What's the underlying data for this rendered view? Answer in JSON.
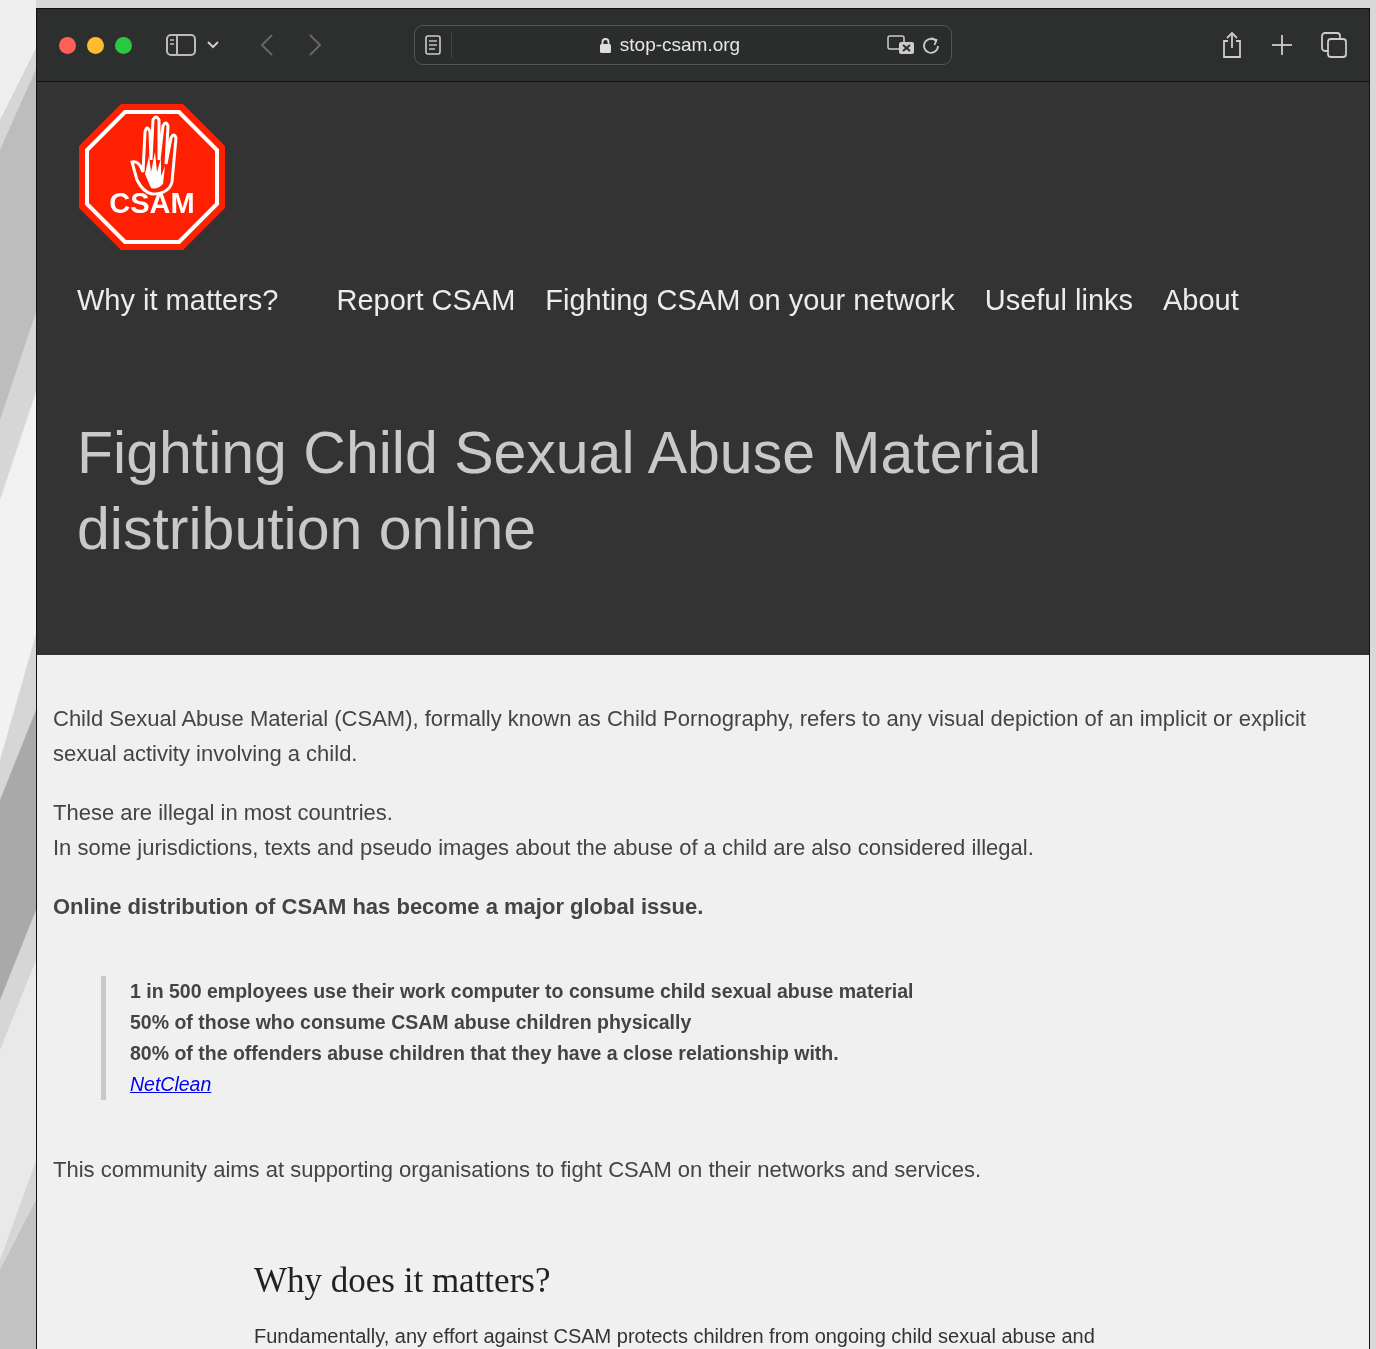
{
  "browser": {
    "url": "stop-csam.org"
  },
  "site": {
    "logo_text": "CSAM",
    "nav": [
      {
        "label": "Why it matters?"
      },
      {
        "label": "Report CSAM"
      },
      {
        "label": "Fighting CSAM on your network"
      },
      {
        "label": "Useful links"
      },
      {
        "label": "About"
      }
    ],
    "hero_title": "Fighting Child Sexual Abuse Material distribution online"
  },
  "content": [
    {
      "kind": "paragraph",
      "lines": [
        "Child Sexual Abuse Material (CSAM), formally known as Child Pornography, refers to any visual depiction of an implicit or explicit sexual activity involving a child."
      ]
    },
    {
      "kind": "paragraph",
      "lines": [
        "These are illegal in most countries.",
        "In some jurisdictions, texts and pseudo images about the abuse of a child are also considered illegal."
      ]
    },
    {
      "kind": "strong",
      "lines": [
        "Online distribution of CSAM has become a major global issue."
      ]
    },
    {
      "kind": "quote",
      "lines": [
        "1 in 500 employees use their work computer to consume child sexual abuse material",
        "50% of those who consume CSAM abuse children physically",
        "80% of the offenders abuse children that they have a close relationship with."
      ],
      "link": "NetClean"
    },
    {
      "kind": "paragraph",
      "lines": [
        "This community aims at supporting organisations to fight CSAM on their networks and services."
      ]
    }
  ],
  "section": {
    "heading": "Why does it matters?",
    "text": "Fundamentally, any effort against CSAM protects children from ongoing child sexual abuse and"
  }
}
